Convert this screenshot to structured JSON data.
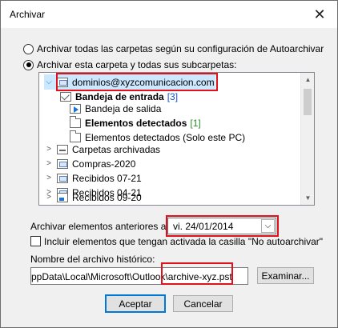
{
  "dialog": {
    "title": "Archivar",
    "close_glyph": "✕"
  },
  "options": {
    "all_folders_label": "Archivar todas las carpetas según su configuración de Autoarchivar",
    "this_folder_label": "Archivar esta carpeta y todas sus subcarpetas:",
    "selected_option": "this_folder"
  },
  "tree": {
    "items": [
      {
        "label": "dominios@xyzcomunicacion.com",
        "icon": "mailbox-icon",
        "expanded": true,
        "selected": true
      },
      {
        "label": "Bandeja de entrada",
        "count": "[3]",
        "icon": "inbox-icon",
        "bold": true
      },
      {
        "label": "Bandeja de salida",
        "icon": "outbox-icon"
      },
      {
        "label": "Elementos detectados",
        "count": "[1]",
        "icon": "folder-icon",
        "bold": true
      },
      {
        "label": "Elementos detectados (Solo este PC)",
        "icon": "folder-icon"
      },
      {
        "label": "Carpetas archivadas",
        "icon": "archive-icon"
      },
      {
        "label": "Compras-2020",
        "icon": "mailbox-icon"
      },
      {
        "label": "Recibidos 07-21",
        "icon": "mailbox-icon"
      },
      {
        "label": "Recibidos 04-21",
        "icon": "mailbox-icon"
      },
      {
        "label": "Recibidos 09-20",
        "icon": "search-folder-icon"
      }
    ]
  },
  "archive_before": {
    "label": "Archivar elementos anteriores al:",
    "value": "vi. 24/01/2014"
  },
  "include_no_autoarchive": {
    "label": "Incluir elementos que tengan activada la casilla \"No autoarchivar\"",
    "checked": false
  },
  "archive_file": {
    "label": "Nombre del archivo histórico:",
    "value": "ppData\\Local\\Microsoft\\Outlook\\archive-xyz.pst",
    "browse_label": "Examinar..."
  },
  "buttons": {
    "accept": "Aceptar",
    "cancel": "Cancelar"
  },
  "colors": {
    "highlight_box": "#e0111b",
    "selection": "#cce8ff",
    "accent": "#0078d7"
  }
}
